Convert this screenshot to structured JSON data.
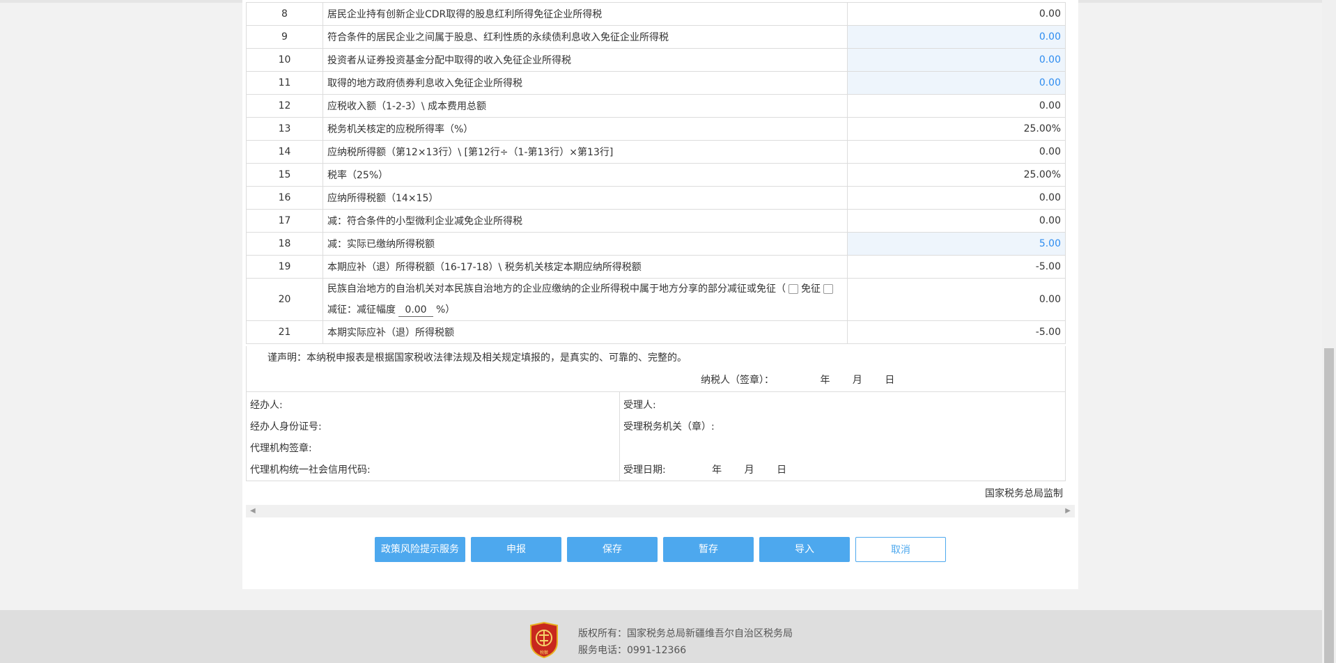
{
  "rows": [
    {
      "no": "8",
      "item": "居民企业持有创新企业CDR取得的股息红利所得免征企业所得税",
      "value": "0.00",
      "editable": false
    },
    {
      "no": "9",
      "item": "符合条件的居民企业之间属于股息、红利性质的永续债利息收入免征企业所得税",
      "value": "0.00",
      "editable": true
    },
    {
      "no": "10",
      "item": "投资者从证券投资基金分配中取得的收入免征企业所得税",
      "value": "0.00",
      "editable": true
    },
    {
      "no": "11",
      "item": "取得的地方政府债券利息收入免征企业所得税",
      "value": "0.00",
      "editable": true
    },
    {
      "no": "12",
      "item": "应税收入额（1-2-3）\\ 成本费用总额",
      "value": "0.00",
      "editable": false
    },
    {
      "no": "13",
      "item": "税务机关核定的应税所得率（%）",
      "value": "25.00%",
      "editable": false
    },
    {
      "no": "14",
      "item": "应纳税所得额（第12×13行）\\ [第12行÷（1-第13行）×第13行]",
      "value": "0.00",
      "editable": false
    },
    {
      "no": "15",
      "item": "税率（25%）",
      "value": "25.00%",
      "editable": false
    },
    {
      "no": "16",
      "item": "应纳所得税额（14×15）",
      "value": "0.00",
      "editable": false
    },
    {
      "no": "17",
      "item": "减：符合条件的小型微利企业减免企业所得税",
      "value": "0.00",
      "editable": false
    },
    {
      "no": "18",
      "item": "减：实际已缴纳所得税额",
      "value": "5.00",
      "editable": true
    },
    {
      "no": "19",
      "item": "本期应补（退）所得税额（16-17-18）\\ 税务机关核定本期应纳所得税额",
      "value": "-5.00",
      "editable": false
    }
  ],
  "row20": {
    "no": "20",
    "line1": "民族自治地方的自治机关对本民族自治地方的企业应缴纳的企业所得税中属于地方分享的部分减征或免征（",
    "exempt_label": "免征",
    "line2_prefix": "减征：减征幅度",
    "rate": "0.00",
    "line2_suffix": "%）",
    "value": "0.00"
  },
  "row21": {
    "no": "21",
    "item": "本期实际应补（退）所得税额",
    "value": "-5.00"
  },
  "declaration": {
    "text": "谨声明：本纳税申报表是根据国家税收法律法规及相关规定填报的，是真实的、可靠的、完整的。",
    "taxpayer_sign": "纳税人（签章）：",
    "year": "年",
    "month": "月",
    "day": "日"
  },
  "sign": {
    "handler": "经办人:",
    "handler_id": "经办人身份证号:",
    "agency_seal": "代理机构签章:",
    "agency_code": "代理机构统一社会信用代码:",
    "receiver": "受理人:",
    "tax_office": "受理税务机关（章）:",
    "accept_date": "受理日期:",
    "year": "年",
    "month": "月",
    "day": "日"
  },
  "supervision": "国家税务总局监制",
  "buttons": {
    "policy": "政策风险提示服务",
    "declare": "申报",
    "save": "保存",
    "temp_save": "暂存",
    "import": "导入",
    "cancel": "取消"
  },
  "footer": {
    "copyright": "版权所有：国家税务总局新疆维吾尔自治区税务局",
    "phone": "服务电话：0991-12366",
    "emblem_text": "税徽"
  },
  "colors": {
    "accent": "#4da8ee",
    "edit_bg": "#eef5fc",
    "edit_text": "#2d8cf0",
    "emblem": "#c8281e"
  }
}
